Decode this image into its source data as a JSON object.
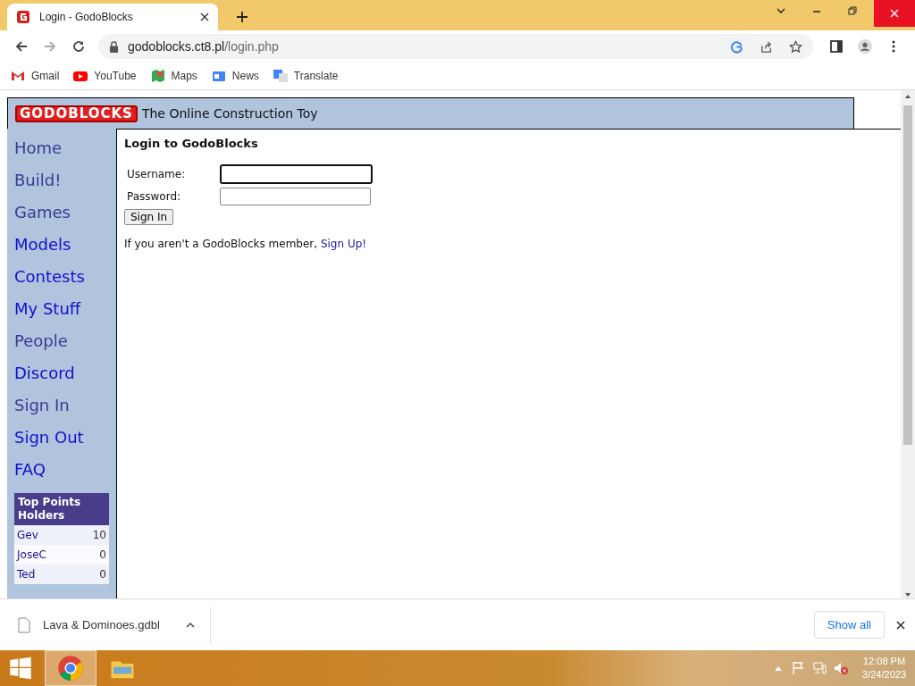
{
  "browser": {
    "tab": {
      "title": "Login - GodoBlocks",
      "selected": true
    },
    "address": {
      "host": "godoblocks.ct8.pl",
      "path": "/login.php"
    },
    "bookmarks": [
      {
        "label": "Gmail",
        "kind": "gmail"
      },
      {
        "label": "YouTube",
        "kind": "youtube"
      },
      {
        "label": "Maps",
        "kind": "maps"
      },
      {
        "label": "News",
        "kind": "news"
      },
      {
        "label": "Translate",
        "kind": "translate"
      }
    ]
  },
  "site": {
    "logo": "GODOBLOCKS",
    "tagline": "The Online Construction Toy",
    "nav": [
      {
        "label": "Home",
        "visited": true
      },
      {
        "label": "Build!",
        "visited": true
      },
      {
        "label": "Games",
        "visited": true
      },
      {
        "label": "Models",
        "visited": false
      },
      {
        "label": "Contests",
        "visited": false
      },
      {
        "label": "My Stuff",
        "visited": false
      },
      {
        "label": "People",
        "visited": true
      },
      {
        "label": "Discord",
        "visited": false
      },
      {
        "label": "Sign In",
        "visited": true
      },
      {
        "label": "Sign Out",
        "visited": false
      },
      {
        "label": "FAQ",
        "visited": false
      }
    ],
    "leaderboard": {
      "title": "Top Points Holders",
      "rows": [
        {
          "name": "Gev",
          "points": "10"
        },
        {
          "name": "JoseC",
          "points": "0"
        },
        {
          "name": "Ted",
          "points": "0"
        }
      ]
    }
  },
  "login": {
    "heading": "Login to GodoBlocks",
    "fields": [
      {
        "label": "Username:",
        "focused": true
      },
      {
        "label": "Password:",
        "focused": false
      }
    ],
    "button": "Sign In",
    "signup_text": "If you aren't a GodoBlocks member, ",
    "signup_link": "Sign Up!"
  },
  "downloads": {
    "file": "Lava & Dominoes.gdbl",
    "show_all": "Show all"
  },
  "taskbar": {
    "time": "12:08 PM",
    "date": "3/24/2023"
  }
}
